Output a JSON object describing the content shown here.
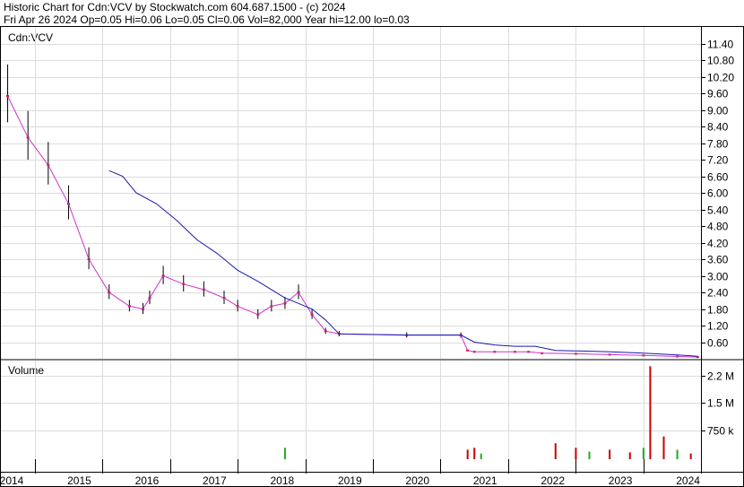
{
  "header": {
    "line1": "Historic Chart for Cdn:VCV by Stockwatch.com 604.687.1500 - (c) 2024",
    "line2": "Fri Apr 26 2024   Op=0.05  Hi=0.06  Lo=0.05  Cl=0.06  Vol=82,000  Year hi=12.00  lo=0.03"
  },
  "chart_data": [
    {
      "type": "line",
      "label": "Cdn:VCV",
      "ylim": [
        0,
        12
      ],
      "y_ticks": [
        "11.40",
        "10.80",
        "10.20",
        "9.60",
        "9.00",
        "8.40",
        "7.80",
        "7.20",
        "6.60",
        "6.00",
        "5.40",
        "4.80",
        "4.20",
        "3.60",
        "3.00",
        "2.40",
        "1.80",
        "1.20",
        "0.60"
      ],
      "grid": true,
      "colors": {
        "price": "#cc0000",
        "bar": "#000000",
        "ma_short": "#cc33cc",
        "ma_long": "#1a1ab0"
      },
      "series": [
        {
          "x": [
            2014.1,
            2014.4,
            2014.7,
            2015.0,
            2015.3,
            2015.6,
            2015.9,
            2016.1,
            2016.2,
            2016.4,
            2016.7,
            2017.0,
            2017.3,
            2017.5,
            2017.8,
            2018.0,
            2018.2,
            2018.4,
            2018.6,
            2018.8,
            2019.0,
            2020.0,
            2020.8,
            2020.9,
            2021.0,
            2021.3,
            2021.6,
            2021.8,
            2022.0,
            2022.5,
            2023.0,
            2023.5,
            2024.0,
            2024.3
          ],
          "values": [
            9.5,
            8.0,
            7.0,
            5.6,
            3.6,
            2.4,
            1.9,
            1.8,
            2.2,
            3.0,
            2.7,
            2.5,
            2.2,
            1.9,
            1.6,
            1.9,
            2.0,
            2.4,
            1.6,
            1.0,
            0.9,
            0.85,
            0.85,
            0.3,
            0.25,
            0.25,
            0.25,
            0.25,
            0.2,
            0.18,
            0.15,
            0.12,
            0.08,
            0.06
          ]
        },
        {
          "x": [
            2015.6,
            2015.8,
            2016.0,
            2016.3,
            2016.6,
            2016.9,
            2017.2,
            2017.5,
            2017.8,
            2018.0,
            2018.2,
            2018.4,
            2018.6,
            2018.8,
            2019.0,
            2020.0,
            2020.8,
            2021.0,
            2021.3,
            2021.6,
            2021.9,
            2022.2,
            2022.6,
            2023.0,
            2023.5,
            2024.0,
            2024.3
          ],
          "values": [
            6.8,
            6.6,
            6.0,
            5.6,
            5.0,
            4.3,
            3.8,
            3.2,
            2.8,
            2.5,
            2.2,
            2.0,
            1.8,
            1.4,
            0.9,
            0.86,
            0.86,
            0.6,
            0.5,
            0.45,
            0.45,
            0.3,
            0.28,
            0.25,
            0.2,
            0.14,
            0.09
          ]
        }
      ]
    },
    {
      "type": "bar",
      "label": "Volume",
      "y_ticks": [
        "2.2 M",
        "1.5 M",
        "750 k"
      ],
      "ylim": [
        0,
        2600000
      ],
      "series": [
        {
          "x": [
            2018.2,
            2020.9,
            2021.0,
            2021.1,
            2022.2,
            2022.5,
            2022.7,
            2023.0,
            2023.3,
            2023.5,
            2023.6,
            2023.8,
            2024.0,
            2024.2
          ],
          "values": [
            300000,
            250000,
            300000,
            150000,
            420000,
            300000,
            200000,
            250000,
            180000,
            300000,
            2450000,
            600000,
            250000,
            150000
          ]
        }
      ]
    }
  ],
  "x_axis": {
    "ticks": [
      "2014",
      "2015",
      "2016",
      "2017",
      "2018",
      "2019",
      "2020",
      "2021",
      "2022",
      "2023",
      "2024"
    ]
  }
}
